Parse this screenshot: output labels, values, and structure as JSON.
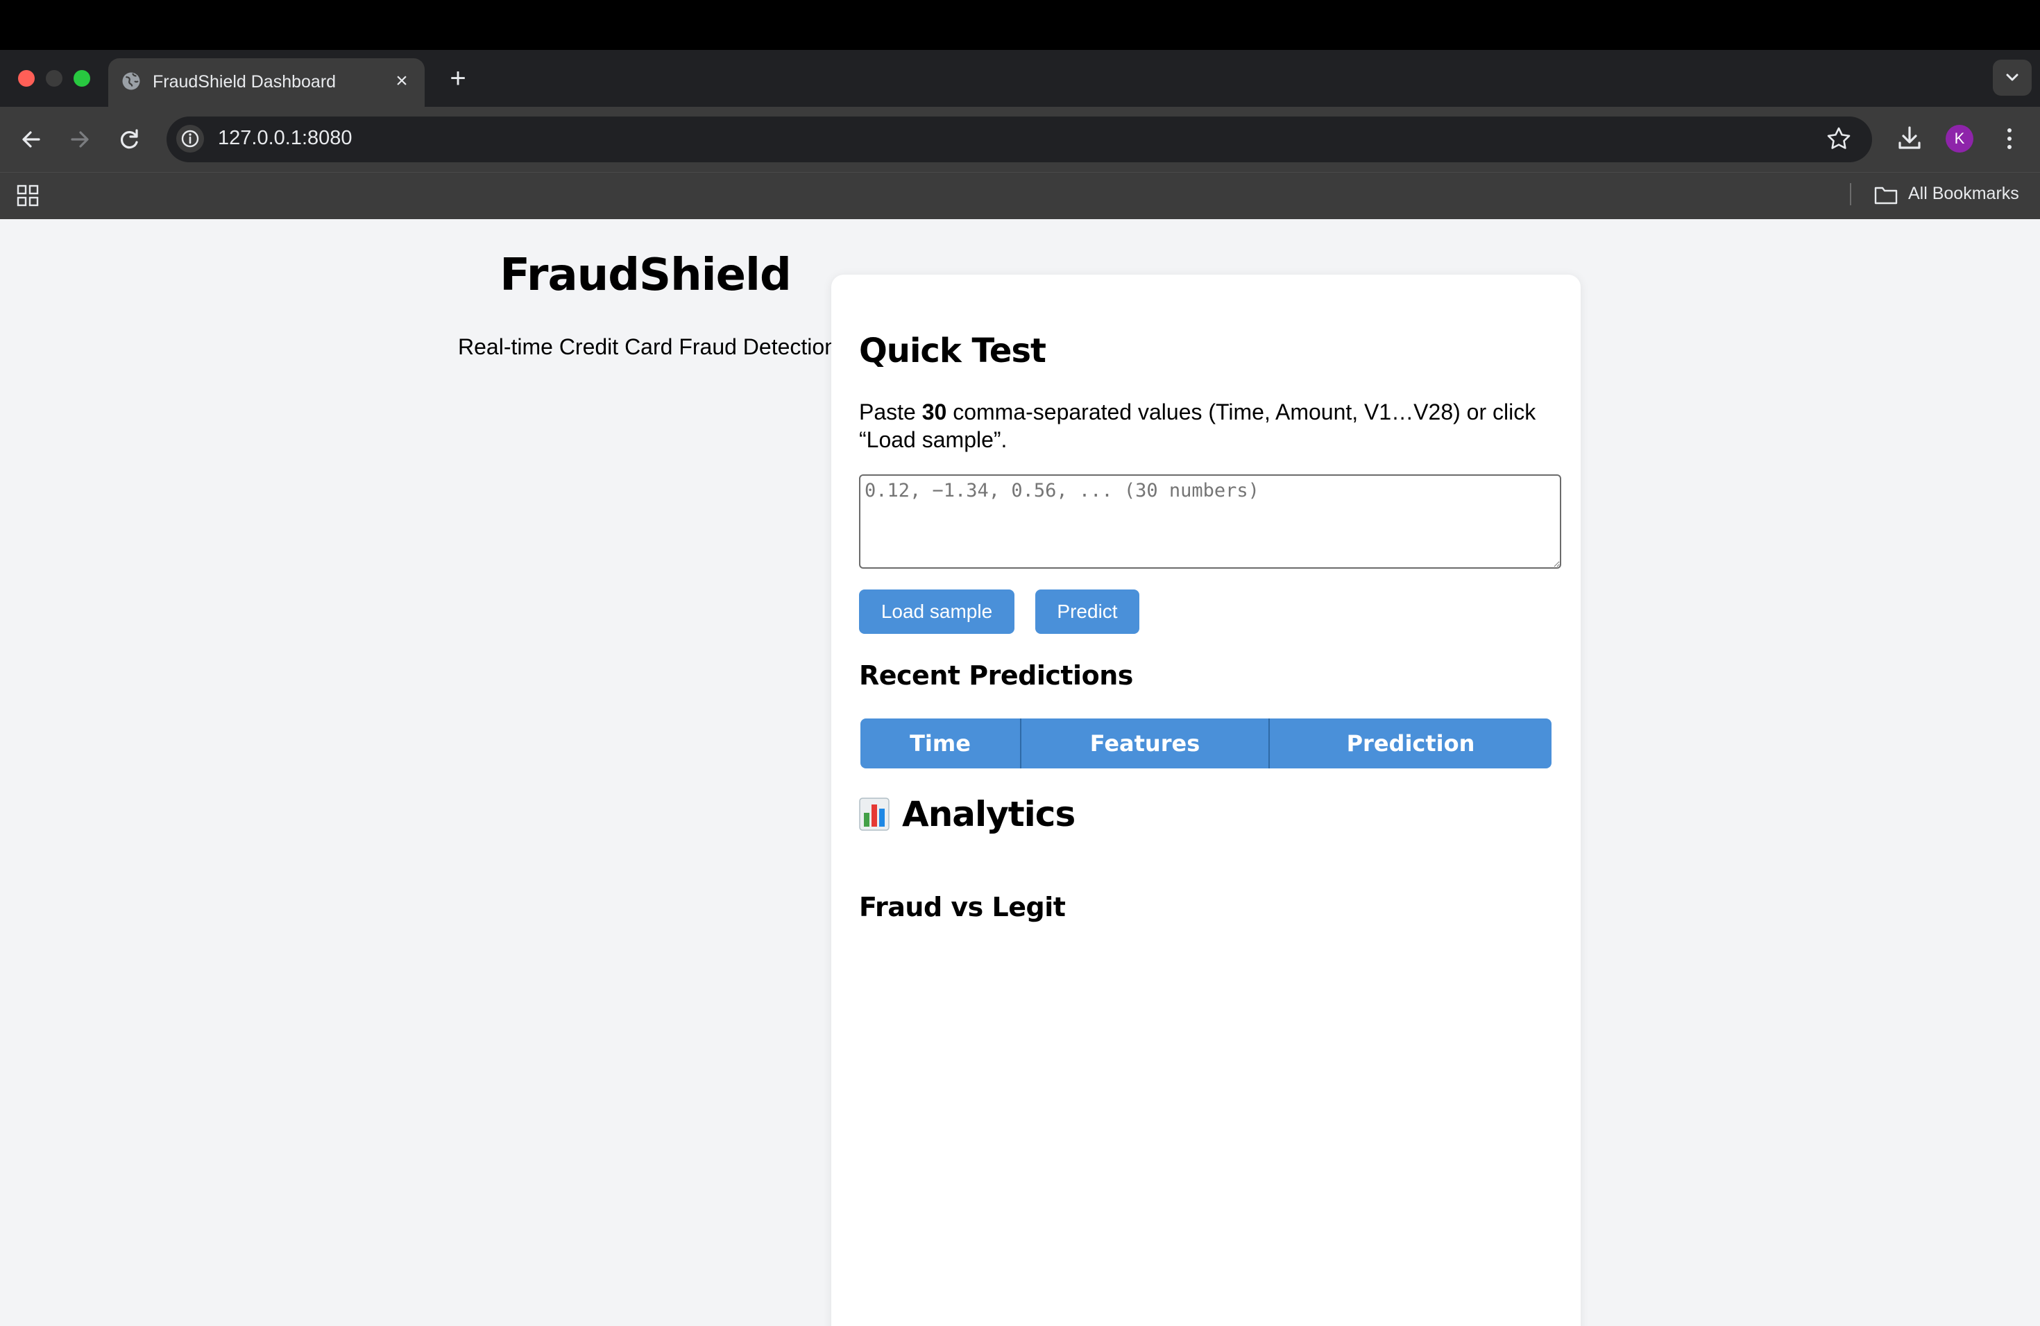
{
  "browser": {
    "tab_title": "FraudShield Dashboard",
    "url": "127.0.0.1:8080",
    "profile_initial": "K",
    "bookmarks_label": "All Bookmarks"
  },
  "page": {
    "brand": "FraudShield",
    "subtitle": "Real-time Credit Card Fraud Detection"
  },
  "quick_test": {
    "title": "Quick Test",
    "instructions_pre": "Paste ",
    "instructions_count": "30",
    "instructions_post": " comma-separated values (Time, Amount, V1…V28) or click “Load sample”.",
    "input_placeholder": "0.12, −1.34, 0.56, ... (30 numbers)",
    "input_value": "",
    "load_sample_label": "Load sample",
    "predict_label": "Predict"
  },
  "recent_predictions": {
    "title": "Recent Predictions",
    "columns": [
      "Time",
      "Features",
      "Prediction"
    ]
  },
  "analytics": {
    "icon": "bar-chart-icon",
    "title": "Analytics",
    "chart_title": "Fraud vs Legit"
  }
}
